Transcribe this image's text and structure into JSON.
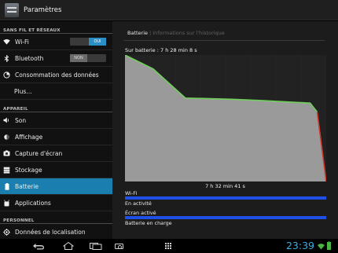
{
  "header": {
    "title": "Paramètres"
  },
  "sidebar": {
    "sections": [
      {
        "title": "SANS FIL ET RÉSEAUX",
        "items": [
          {
            "label": "Wi-Fi",
            "icon": "wifi-icon",
            "toggle": "OUI",
            "toggle_state": "on"
          },
          {
            "label": "Bluetooth",
            "icon": "bluetooth-icon",
            "toggle": "NON",
            "toggle_state": "off"
          },
          {
            "label": "Consommation des données",
            "icon": "data-usage-icon"
          },
          {
            "label": "Plus…",
            "icon": ""
          }
        ]
      },
      {
        "title": "APPAREIL",
        "items": [
          {
            "label": "Son",
            "icon": "speaker-icon"
          },
          {
            "label": "Affichage",
            "icon": "display-icon"
          },
          {
            "label": "Capture d'écran",
            "icon": "screenshot-icon"
          },
          {
            "label": "Stockage",
            "icon": "storage-icon"
          },
          {
            "label": "Batterie",
            "icon": "battery-icon",
            "selected": true
          },
          {
            "label": "Applications",
            "icon": "apps-icon"
          }
        ]
      },
      {
        "title": "PERSONNEL",
        "items": [
          {
            "label": "Données de localisation",
            "icon": "location-icon"
          }
        ]
      }
    ]
  },
  "breadcrumbs": {
    "active": "Batterie",
    "inactive": "Informations sur l'historique"
  },
  "battery": {
    "on_battery_label": "Sur batterie : 7 h 28 min 8 s",
    "duration_label": "7 h 32 min 41 s",
    "status_rows": [
      {
        "label": "Wi-Fi",
        "bar": true
      },
      {
        "label": "En activité",
        "bar": false
      },
      {
        "label": "Écran activé",
        "bar": true
      },
      {
        "label": "Batterie en charge",
        "bar": false
      }
    ]
  },
  "chart_data": {
    "type": "area",
    "title": "",
    "xlabel": "",
    "ylabel": "",
    "x": [
      0,
      0.14,
      0.3,
      0.53,
      0.68,
      0.92,
      0.955,
      1.0
    ],
    "values": [
      100,
      89,
      66,
      65,
      64,
      62,
      55,
      0
    ],
    "xlim": [
      0,
      1
    ],
    "ylim": [
      0,
      100
    ],
    "grid": true,
    "fill_color": "#9a9a9a",
    "line_color": "#6fd05a",
    "drop_color": "#d23b2b"
  },
  "systembar": {
    "clock": "23:39"
  },
  "colors": {
    "accent": "#1a7fae",
    "status_bar": "#1f4fe6",
    "clock": "#34b0e6"
  }
}
